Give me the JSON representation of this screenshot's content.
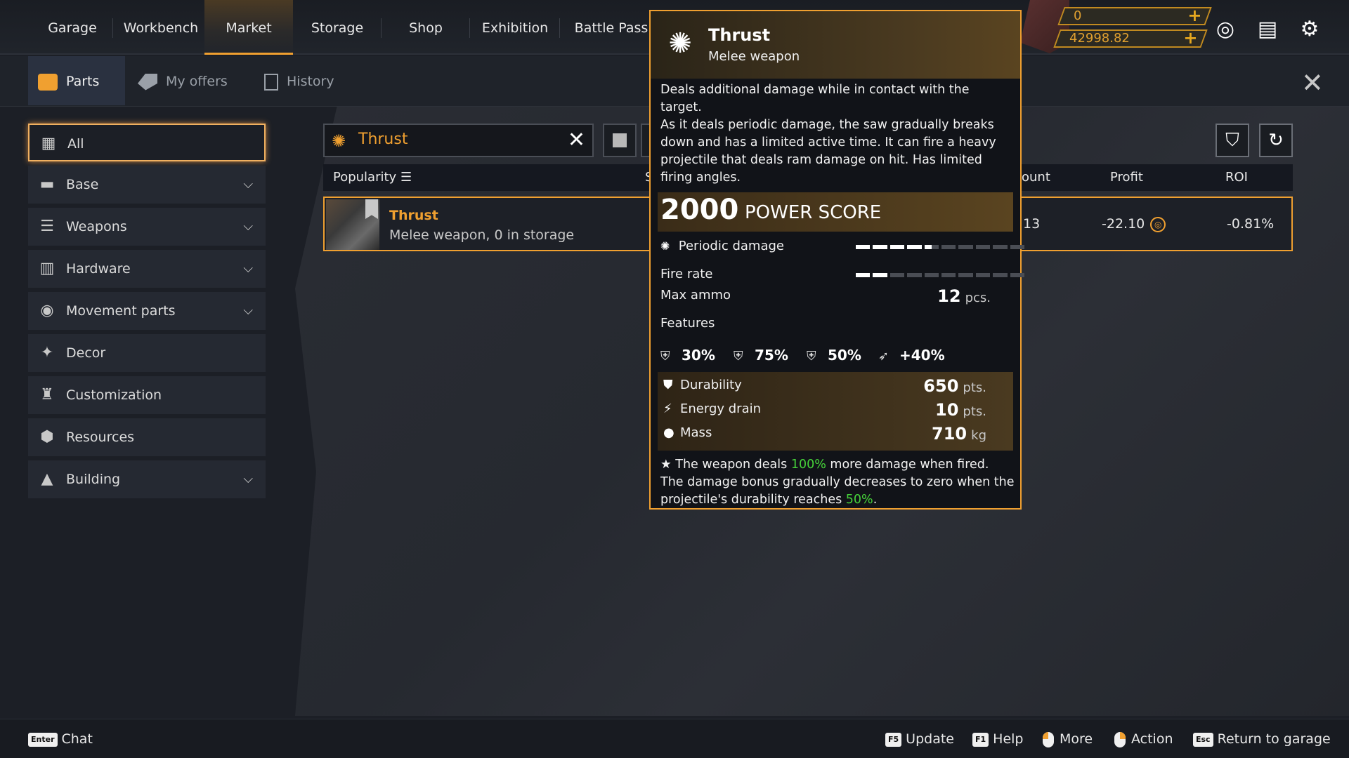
{
  "nav": {
    "tabs": [
      "Garage",
      "Workbench",
      "Market",
      "Storage",
      "Shop",
      "Exhibition",
      "Battle Pass"
    ],
    "active": "Market"
  },
  "currency": {
    "coupons": "0",
    "coins": "42998.82"
  },
  "subnav": {
    "tabs": [
      "Parts",
      "My offers",
      "History"
    ],
    "active": "Parts"
  },
  "sidebar": {
    "items": [
      {
        "label": "All",
        "icon": "grid-icon",
        "expandable": false
      },
      {
        "label": "Base",
        "icon": "car-icon",
        "expandable": true
      },
      {
        "label": "Weapons",
        "icon": "gun-icon",
        "expandable": true
      },
      {
        "label": "Hardware",
        "icon": "hardware-icon",
        "expandable": true
      },
      {
        "label": "Movement parts",
        "icon": "wheel-icon",
        "expandable": true
      },
      {
        "label": "Decor",
        "icon": "decor-icon",
        "expandable": false
      },
      {
        "label": "Customization",
        "icon": "brush-icon",
        "expandable": false
      },
      {
        "label": "Resources",
        "icon": "resources-icon",
        "expandable": false
      },
      {
        "label": "Building",
        "icon": "building-icon",
        "expandable": true
      }
    ]
  },
  "search": {
    "value": "Thrust"
  },
  "table": {
    "headers": {
      "popularity": "Popularity",
      "s": "S",
      "amount": "ount",
      "profit": "Profit",
      "roi": "ROI"
    },
    "row": {
      "name": "Thrust",
      "subtitle": "Melee weapon, 0 in storage",
      "amount": "13",
      "profit": "-22.10",
      "roi": "-0.81%"
    }
  },
  "tooltip": {
    "title": "Thrust",
    "type": "Melee weapon",
    "desc1": "Deals additional damage while in contact with the target.",
    "desc2": "As it deals periodic damage, the saw gradually breaks down and has a limited active time. It can fire a heavy projectile that deals ram damage on hit. Has limited firing angles.",
    "power_score": "2000",
    "power_label": "POWER SCORE",
    "periodic_damage_label": "Periodic damage",
    "periodic_damage_level": 0.45,
    "fire_rate_label": "Fire rate",
    "fire_rate_level": 0.2,
    "max_ammo_label": "Max ammo",
    "max_ammo_value": "12",
    "max_ammo_unit": "pcs.",
    "features_label": "Features",
    "features": [
      "30%",
      "75%",
      "50%",
      "+40%"
    ],
    "durability_label": "Durability",
    "durability_value": "650",
    "energy_label": "Energy drain",
    "energy_value": "10",
    "pts_unit": "pts.",
    "mass_label": "Mass",
    "mass_value": "710",
    "mass_unit": "kg",
    "note_a": "The weapon deals ",
    "note_pct1": "100%",
    "note_b": " more damage when fired. The damage bonus gradually decreases to zero when the projectile's durability reaches ",
    "note_pct2": "50%",
    "note_c": "."
  },
  "bottom": {
    "chat_key": "Enter",
    "chat": "Chat",
    "update_key": "F5",
    "update": "Update",
    "help_key": "F1",
    "help": "Help",
    "more": "More",
    "action": "Action",
    "return_key": "Esc",
    "return": "Return to garage"
  }
}
